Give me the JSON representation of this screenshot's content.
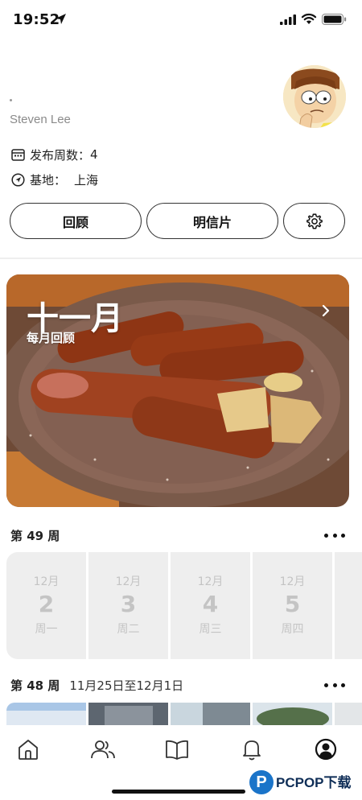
{
  "status_bar": {
    "time": "19:52"
  },
  "profile": {
    "username": "Steven Lee",
    "weeks_label": "发布周数：",
    "weeks_value": "4",
    "base_label": "基地：",
    "base_value": "上海"
  },
  "buttons": {
    "review": "回顾",
    "postcard": "明信片"
  },
  "monthly_card": {
    "title": "十一月",
    "subtitle": "每月回顾"
  },
  "week49": {
    "title": "第 49 周",
    "days": [
      {
        "month": "12月",
        "day": "2",
        "weekday": "周一"
      },
      {
        "month": "12月",
        "day": "3",
        "weekday": "周二"
      },
      {
        "month": "12月",
        "day": "4",
        "weekday": "周三"
      },
      {
        "month": "12月",
        "day": "5",
        "weekday": "周四"
      }
    ]
  },
  "week48": {
    "title": "第 48 周",
    "range": "11月25日至12月1日"
  },
  "tabbar": {
    "items": [
      "home-icon",
      "friends-icon",
      "book-icon",
      "bell-icon",
      "profile-icon"
    ]
  },
  "watermark": {
    "text": "PCPOP下载"
  },
  "colors": {
    "accent": "#111111",
    "day_cell_bg": "#eeeeee",
    "day_text": "#c4c4c4",
    "watermark_blue": "#1a74c9"
  }
}
